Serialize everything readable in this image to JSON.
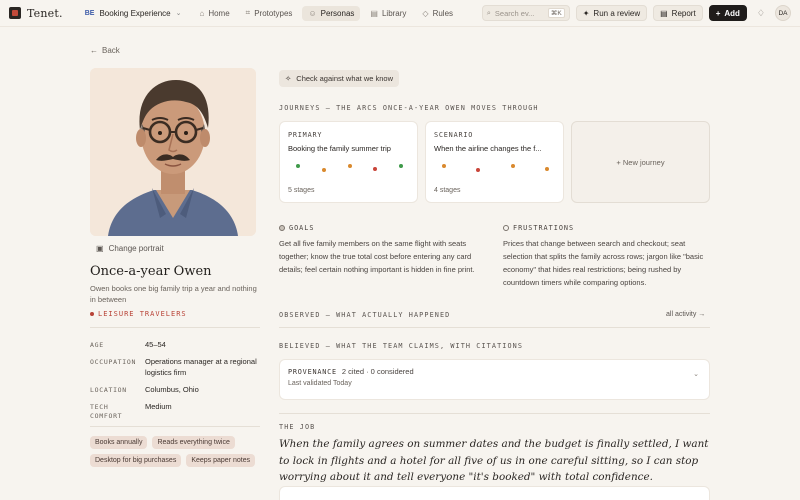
{
  "app": {
    "brand": "Tenet."
  },
  "workspace": {
    "badge": "BE",
    "name": "Booking Experience"
  },
  "nav": [
    {
      "label": "Home",
      "icon": "home-icon",
      "glyph": "⌂"
    },
    {
      "label": "Prototypes",
      "icon": "grid-icon",
      "glyph": "⌗"
    },
    {
      "label": "Personas",
      "icon": "persona-icon",
      "glyph": "☺"
    },
    {
      "label": "Library",
      "icon": "book-icon",
      "glyph": "▤"
    },
    {
      "label": "Rules",
      "icon": "shield-icon",
      "glyph": "◇"
    }
  ],
  "search": {
    "placeholder": "Search ev...",
    "shortcut": "⌘K"
  },
  "toolbar": {
    "run_review": "Run a review",
    "report": "Report",
    "add": "Add"
  },
  "user": {
    "initials": "DA"
  },
  "persona": {
    "back": "Back",
    "change_portrait": "Change portrait",
    "name": "Once-a-year Owen",
    "tagline": "Owen books one big family trip a year and nothing in between",
    "segment": "LEISURE TRAVELERS",
    "attributes": [
      {
        "key": "AGE",
        "value": "45–54"
      },
      {
        "key": "OCCUPATION",
        "value": "Operations manager at a regional logistics firm"
      },
      {
        "key": "LOCATION",
        "value": "Columbus, Ohio"
      },
      {
        "key": "TECH COMFORT",
        "value": "Medium"
      }
    ],
    "tags": [
      "Books annually",
      "Reads everything twice",
      "Desktop for big purchases",
      "Keeps paper notes"
    ]
  },
  "main": {
    "check_button": "Check against what we know",
    "journeys_heading": "JOURNEYS — THE ARCS ONCE-A-YEAR OWEN MOVES THROUGH",
    "journeys": [
      {
        "label": "PRIMARY",
        "title": "Booking the family summer trip",
        "stages": "5 stages",
        "dots": [
          "#3f9a4a",
          "#d9892e",
          "#d9892e",
          "#c9453a",
          "#3f9a4a"
        ]
      },
      {
        "label": "SCENARIO",
        "title": "When the airline changes the f...",
        "stages": "4 stages",
        "dots": [
          "#d9892e",
          "#c9453a",
          "#d9892e",
          "#d9892e"
        ]
      }
    ],
    "new_journey": "+ New journey",
    "goals": {
      "heading": "GOALS",
      "text": "Get all five family members on the same flight with seats together; know the true total cost before entering any card details; feel certain nothing important is hidden in fine print."
    },
    "frustrations": {
      "heading": "FRUSTRATIONS",
      "text": "Prices that change between search and checkout; seat selection that splits the family across rows; jargon like \"basic economy\" that hides real restrictions; being rushed by countdown timers while comparing options."
    },
    "observed_heading": "OBSERVED — WHAT ACTUALLY HAPPENED",
    "all_activity": "all activity →",
    "believed_heading": "BELIEVED — WHAT THE TEAM CLAIMS, WITH CITATIONS",
    "provenance": {
      "label": "PROVENANCE",
      "counts": "2 cited · 0 considered",
      "validated": "Last validated Today"
    },
    "job_heading": "THE JOB",
    "job_text": "When the family agrees on summer dates and the budget is finally settled, I want to lock in flights and a hotel for all five of us in one careful sitting, so I can stop worrying about it and tell everyone \"it's booked\" with total confidence."
  }
}
